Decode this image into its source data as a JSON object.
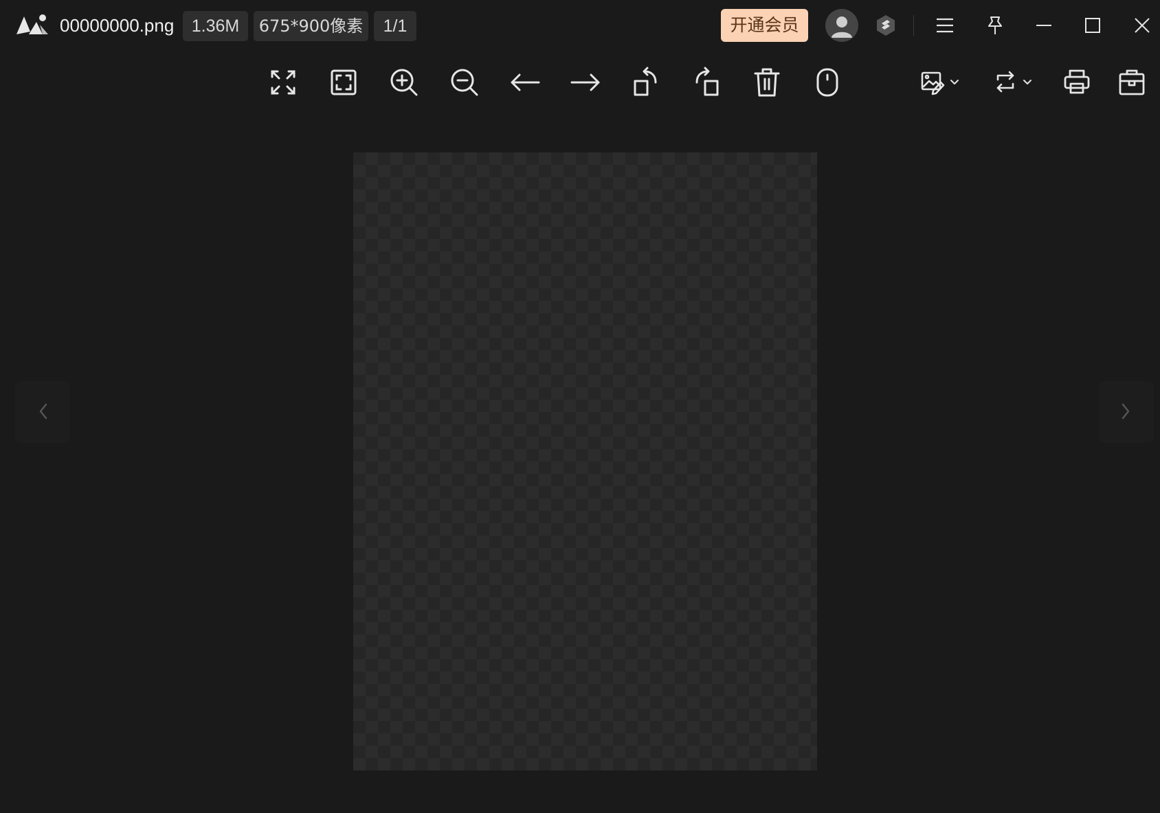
{
  "app": {
    "filename": "00000000.png",
    "file_size": "1.36M",
    "dimensions": "675*900像素",
    "page_counter": "1/1"
  },
  "header": {
    "vip_button_label": "开通会员"
  },
  "toolbar": {
    "items": [
      {
        "name": "fit-fullscreen-icon"
      },
      {
        "name": "actual-size-icon"
      },
      {
        "name": "zoom-in-icon"
      },
      {
        "name": "zoom-out-icon"
      },
      {
        "name": "previous-icon"
      },
      {
        "name": "next-icon"
      },
      {
        "name": "rotate-left-icon"
      },
      {
        "name": "rotate-right-icon"
      },
      {
        "name": "delete-icon"
      },
      {
        "name": "mouse-mode-icon"
      },
      {
        "name": "edit-image-icon"
      },
      {
        "name": "convert-crop-icon"
      },
      {
        "name": "print-icon"
      },
      {
        "name": "toolbox-icon"
      }
    ]
  },
  "colors": {
    "background": "#1a1a1a",
    "vip_button_bg": "#fbd2b4",
    "vip_button_text": "#5a3418",
    "badge_bg": "#2e2e2e",
    "icon": "#e6e6e6"
  }
}
